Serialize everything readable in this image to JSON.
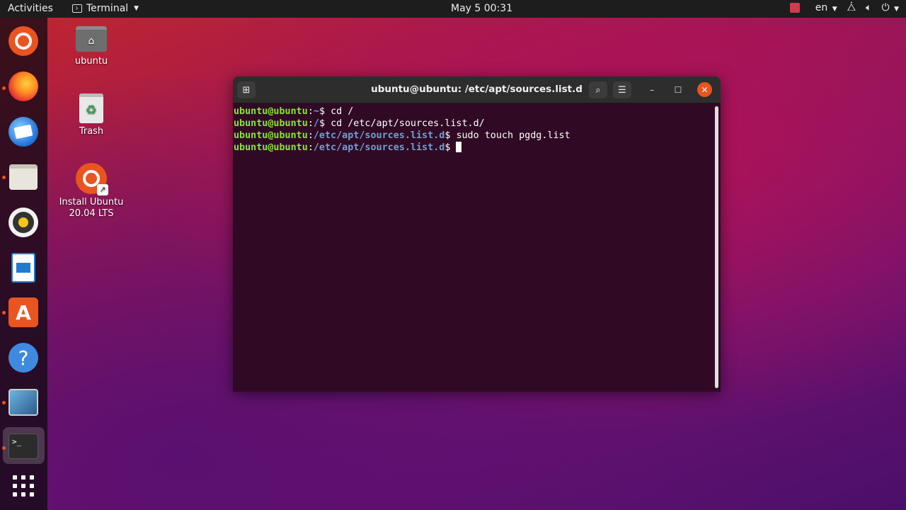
{
  "topbar": {
    "activities": "Activities",
    "app_name": "Terminal",
    "clock": "May 5  00:31",
    "lang": "en"
  },
  "desktop": {
    "icons": [
      {
        "label": "ubuntu",
        "icon": "home-folder-icon"
      },
      {
        "label": "Trash",
        "icon": "trash-icon"
      },
      {
        "label": "Install Ubuntu\n20.04 LTS",
        "icon": "install-ubuntu-icon"
      }
    ]
  },
  "dock": {
    "items": [
      "ubuntu-logo-icon",
      "firefox-icon",
      "thunderbird-icon",
      "files-icon",
      "rhythmbox-icon",
      "libreoffice-writer-icon",
      "ubuntu-software-icon",
      "help-icon",
      "screenshot-icon",
      "terminal-icon",
      "show-applications-icon"
    ]
  },
  "terminal": {
    "title": "ubuntu@ubuntu: /etc/apt/sources.list.d",
    "lines": [
      {
        "user": "ubuntu@ubuntu",
        "path": "~",
        "cmd": "cd /"
      },
      {
        "user": "ubuntu@ubuntu",
        "path": "/",
        "cmd": "cd /etc/apt/sources.list.d/"
      },
      {
        "user": "ubuntu@ubuntu",
        "path": "/etc/apt/sources.list.d",
        "cmd": "sudo touch pgdg.list"
      },
      {
        "user": "ubuntu@ubuntu",
        "path": "/etc/apt/sources.list.d",
        "cmd": ""
      }
    ],
    "prompt_sep": ":",
    "prompt_end": "$ "
  },
  "colors": {
    "accent": "#e95420",
    "terminal_bg": "#300a24",
    "prompt_user": "#8ae234",
    "prompt_path": "#729fcf"
  }
}
